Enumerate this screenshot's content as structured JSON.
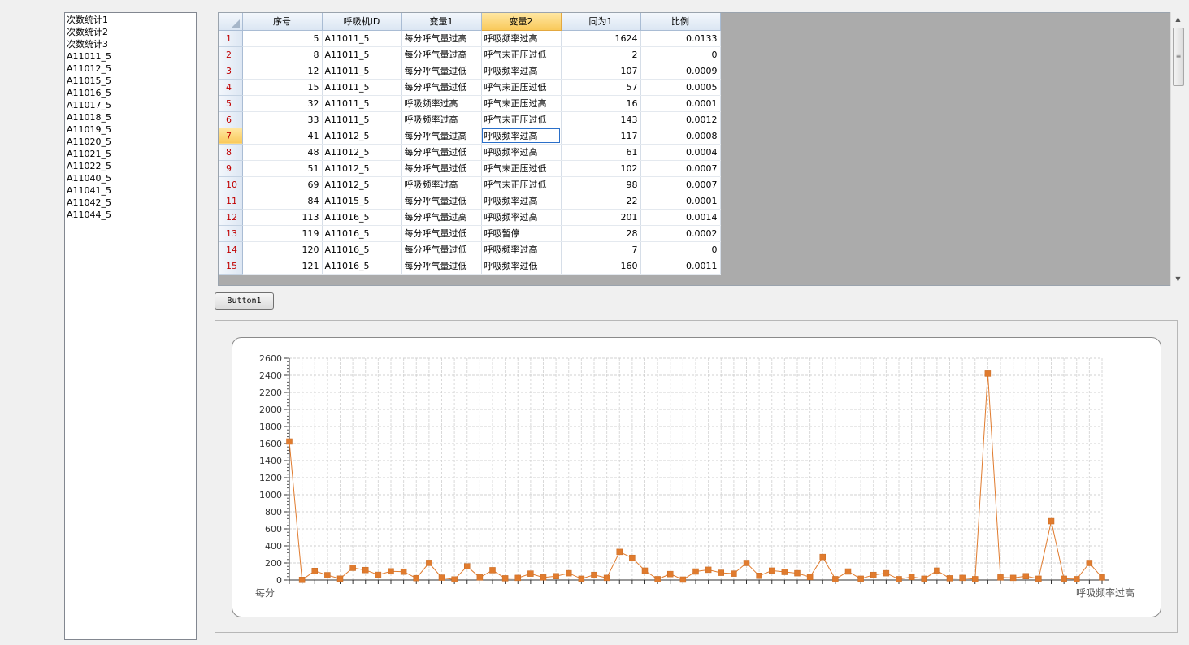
{
  "left_list": {
    "items": [
      "次数统计1",
      "次数统计2",
      "次数统计3",
      "A11011_5",
      "A11012_5",
      "A11015_5",
      "A11016_5",
      "A11017_5",
      "A11018_5",
      "A11019_5",
      "A11020_5",
      "A11021_5",
      "A11022_5",
      "A11040_5",
      "A11041_5",
      "A11042_5",
      "A11044_5"
    ]
  },
  "grid": {
    "columns": [
      "序号",
      "呼吸机ID",
      "变量1",
      "变量2",
      "同为1",
      "比例"
    ],
    "selected_column": 3,
    "selected_row": 7,
    "rows": [
      {
        "n": "1",
        "seq": "5",
        "id": "A11011_5",
        "v1": "每分呼气量过高",
        "v2": "呼吸频率过高",
        "same": "1624",
        "ratio": "0.0133"
      },
      {
        "n": "2",
        "seq": "8",
        "id": "A11011_5",
        "v1": "每分呼气量过高",
        "v2": "呼气末正压过低",
        "same": "2",
        "ratio": "0"
      },
      {
        "n": "3",
        "seq": "12",
        "id": "A11011_5",
        "v1": "每分呼气量过低",
        "v2": "呼吸频率过高",
        "same": "107",
        "ratio": "0.0009"
      },
      {
        "n": "4",
        "seq": "15",
        "id": "A11011_5",
        "v1": "每分呼气量过低",
        "v2": "呼气末正压过低",
        "same": "57",
        "ratio": "0.0005"
      },
      {
        "n": "5",
        "seq": "32",
        "id": "A11011_5",
        "v1": "呼吸频率过高",
        "v2": "呼气末正压过高",
        "same": "16",
        "ratio": "0.0001"
      },
      {
        "n": "6",
        "seq": "33",
        "id": "A11011_5",
        "v1": "呼吸频率过高",
        "v2": "呼气末正压过低",
        "same": "143",
        "ratio": "0.0012"
      },
      {
        "n": "7",
        "seq": "41",
        "id": "A11012_5",
        "v1": "每分呼气量过高",
        "v2": "呼吸频率过高",
        "same": "117",
        "ratio": "0.0008"
      },
      {
        "n": "8",
        "seq": "48",
        "id": "A11012_5",
        "v1": "每分呼气量过低",
        "v2": "呼吸频率过高",
        "same": "61",
        "ratio": "0.0004"
      },
      {
        "n": "9",
        "seq": "51",
        "id": "A11012_5",
        "v1": "每分呼气量过低",
        "v2": "呼气末正压过低",
        "same": "102",
        "ratio": "0.0007"
      },
      {
        "n": "10",
        "seq": "69",
        "id": "A11012_5",
        "v1": "呼吸频率过高",
        "v2": "呼气末正压过低",
        "same": "98",
        "ratio": "0.0007"
      },
      {
        "n": "11",
        "seq": "84",
        "id": "A11015_5",
        "v1": "每分呼气量过低",
        "v2": "呼吸频率过高",
        "same": "22",
        "ratio": "0.0001"
      },
      {
        "n": "12",
        "seq": "113",
        "id": "A11016_5",
        "v1": "每分呼气量过高",
        "v2": "呼吸频率过高",
        "same": "201",
        "ratio": "0.0014"
      },
      {
        "n": "13",
        "seq": "119",
        "id": "A11016_5",
        "v1": "每分呼气量过低",
        "v2": "呼吸暂停",
        "same": "28",
        "ratio": "0.0002"
      },
      {
        "n": "14",
        "seq": "120",
        "id": "A11016_5",
        "v1": "每分呼气量过低",
        "v2": "呼吸频率过高",
        "same": "7",
        "ratio": "0"
      },
      {
        "n": "15",
        "seq": "121",
        "id": "A11016_5",
        "v1": "每分呼气量过低",
        "v2": "呼吸频率过低",
        "same": "160",
        "ratio": "0.0011"
      }
    ]
  },
  "button1": {
    "label": "Button1"
  },
  "chart_data": {
    "type": "line",
    "title": "",
    "xlabel": "",
    "ylabel": "",
    "ylim": [
      0,
      2600
    ],
    "y_ticks": [
      0,
      200,
      400,
      600,
      800,
      1000,
      1200,
      1400,
      1600,
      1800,
      2000,
      2200,
      2400,
      2600
    ],
    "grid": true,
    "color": "#e07b2e",
    "first_category_label": "每分",
    "last_category_label": "呼吸频率过高",
    "values": [
      1624,
      2,
      107,
      57,
      16,
      143,
      117,
      61,
      102,
      98,
      22,
      201,
      28,
      7,
      160,
      30,
      115,
      20,
      25,
      75,
      30,
      45,
      80,
      15,
      60,
      25,
      330,
      260,
      110,
      10,
      70,
      5,
      100,
      120,
      85,
      75,
      200,
      50,
      110,
      95,
      80,
      35,
      270,
      10,
      100,
      15,
      60,
      80,
      10,
      35,
      15,
      110,
      20,
      25,
      10,
      2420,
      30,
      25,
      45,
      15,
      690,
      15,
      10,
      200,
      30
    ],
    "marker": "square"
  },
  "scrollbar": {
    "up": "▲",
    "down": "▼",
    "grip": "≡"
  }
}
